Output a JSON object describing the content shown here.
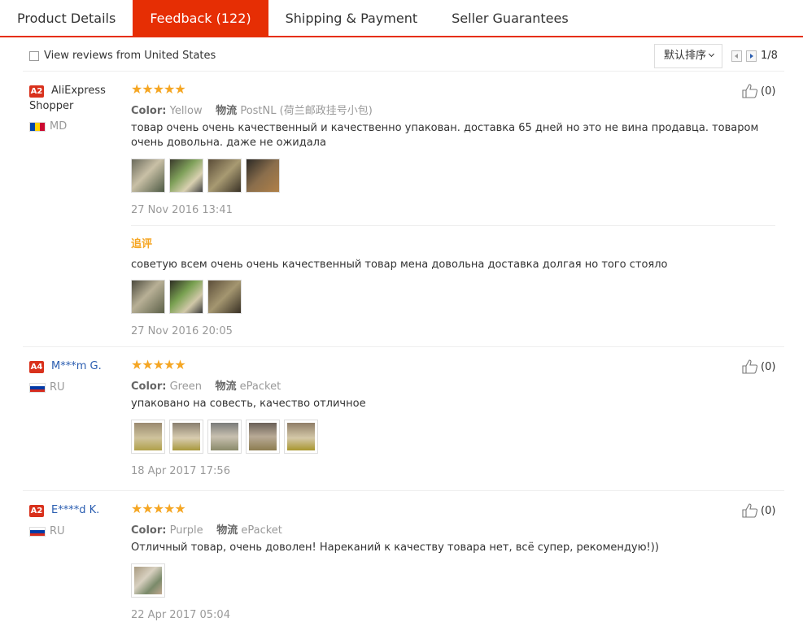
{
  "tabs": [
    {
      "label": "Product Details"
    },
    {
      "label": "Feedback (122)"
    },
    {
      "label": "Shipping & Payment"
    },
    {
      "label": "Seller Guarantees"
    }
  ],
  "toolbar": {
    "us_filter_label": "View reviews from United States",
    "us_filter_checked": false,
    "sort_label": "默认排序",
    "page_indicator": "1/8"
  },
  "reviews": [
    {
      "level": "A2",
      "name": "AliExpress Shopper",
      "country": "MD",
      "stars": 5,
      "color_label": "Color:",
      "color_value": "Yellow",
      "logistics_label": "物流",
      "logistics_value": "PostNL (荷兰邮政挂号小包)",
      "text": "товар очень очень качественный и качественно упакован. доставка 65 дней но это не вина продавца. товаром очень довольна. даже не ожидала",
      "photo_count": 4,
      "date": "27 Nov 2016 13:41",
      "followup_label": "追评",
      "followup_text": "советую всем очень очень качественный товар мена довольна доставка долгая но того стояло",
      "followup_photo_count": 3,
      "followup_date": "27 Nov 2016 20:05",
      "helpful": "(0)"
    },
    {
      "level": "A4",
      "name": "M***m G.",
      "country": "RU",
      "stars": 5,
      "color_label": "Color:",
      "color_value": "Green",
      "logistics_label": "物流",
      "logistics_value": "ePacket",
      "text": "упаковано на совесть, качество отличное",
      "photo_count": 5,
      "date": "18 Apr 2017 17:56",
      "helpful": "(0)"
    },
    {
      "level": "A2",
      "name": "E****d K.",
      "country": "RU",
      "stars": 5,
      "color_label": "Color:",
      "color_value": "Purple",
      "logistics_label": "物流",
      "logistics_value": "ePacket",
      "text": "Отличный товар, очень доволен! Нареканий к качеству товара нет, всё супер, рекомендую!))",
      "photo_count": 1,
      "date": "22 Apr 2017 05:04",
      "helpful": "(0)"
    }
  ],
  "colors": {
    "accent": "#e62e04",
    "star": "#f5a623",
    "link": "#2a5db0",
    "badge": "#d9311c"
  }
}
